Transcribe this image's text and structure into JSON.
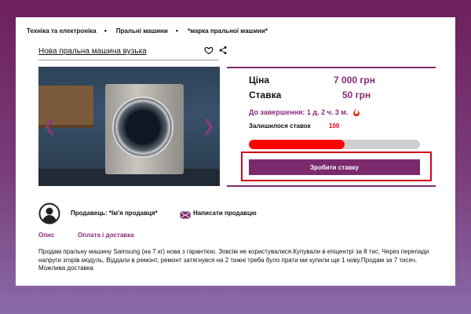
{
  "breadcrumb": {
    "items": [
      "Техніка та електроніка",
      "Пральні машини",
      "*марка пральної машини*"
    ],
    "separator": "•"
  },
  "product": {
    "title": "Нова пральна машина вузька"
  },
  "icons": {
    "favorite": "heart-icon",
    "share": "share-icon",
    "prev": "chevron-left-icon",
    "next": "chevron-right-icon",
    "fire": "fire-icon",
    "avatar": "user-avatar-icon",
    "mail": "mail-icon"
  },
  "auction": {
    "price_label": "Ціна",
    "price_value": "7 000 грн",
    "bid_label": "Ставка",
    "bid_value": "50 грн",
    "deadline": "До завершення: 1 д. 2 ч. 3 м.",
    "remaining_label": "Залишилося ставок",
    "remaining_count": "100",
    "progress_fraction": 0.56,
    "bid_button": "Зробити ставку"
  },
  "seller": {
    "label": "Продавець: *Ім'я продавця*",
    "contact": "Написати продавцю"
  },
  "tabs": [
    "Опис",
    "Оплата і доставка"
  ],
  "description": "Продам пральну машину Samsung (на 7 кг) нова з гарантією. Зовсім не користувалися.Купували в епіцентрі за 8 тис. Через перепади напруги згорів модуль, Віддали в ремонт, ремонт затягнувся на 2 тижні треба було прати ми купили ще 1 нову.Продам за 7 тисяч. Можлива доставка",
  "colors": {
    "accent": "#7b2a6e",
    "price": "#8a2a7a",
    "alert": "#e0001b",
    "progress": "#ff0000"
  }
}
